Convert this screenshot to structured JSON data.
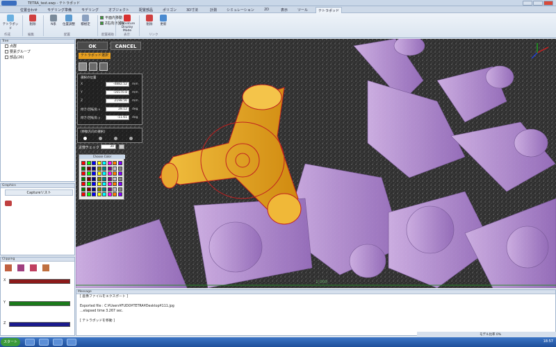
{
  "window": {
    "title": "TETRA_test.ewp - テトラポッド"
  },
  "tabs": [
    "位置合わせ",
    "モデリング準備",
    "モデリング",
    "オブジェクト",
    "配置部品",
    "ポリゴン",
    "3D寸法",
    "計測",
    "シミュレーション",
    "2D",
    "表示",
    "ツール",
    "テトラポッド"
  ],
  "ribbon": {
    "buttons": [
      {
        "label": "テトラポッド",
        "icon": "tetrapod-icon"
      },
      {
        "label": "削除",
        "icon": "delete-icon"
      },
      {
        "label": "N系",
        "icon": "n-system-icon"
      },
      {
        "label": "位置調整",
        "icon": "position-adjust-icon"
      },
      {
        "label": "積極定",
        "icon": "setting-icon"
      },
      {
        "label": "Curvature Display Mode",
        "icon": "curvature-icon"
      },
      {
        "label": "削除",
        "icon": "delete-icon-2"
      },
      {
        "label": "更新",
        "icon": "refresh-icon"
      }
    ],
    "checks": [
      {
        "label": "平面内移動",
        "checked": true
      },
      {
        "label": "Z右向き回転",
        "checked": true
      }
    ],
    "groups": [
      "作成",
      "編集",
      "配置",
      "配置補助",
      "表示",
      "リンク"
    ]
  },
  "tree": {
    "header": "Tree",
    "items": [
      {
        "label": "点群",
        "icon": "pointcloud-icon"
      },
      {
        "label": "要素グループ",
        "icon": "group-icon"
      },
      {
        "label": "部品(26)",
        "icon": "parts-icon"
      }
    ]
  },
  "capture": {
    "header": "Graphics",
    "tab": "Captureリスト"
  },
  "clipping": {
    "header": "Clipping",
    "axes": [
      "X",
      "Y",
      "Z"
    ]
  },
  "viewport": {
    "ok_label": "OK",
    "cancel_label": "CANCEL",
    "mode_label": "テトラポッド選択",
    "position_header": "選択の位置",
    "fields": [
      {
        "label": "X",
        "value": "-4882.52",
        "unit": "mm"
      },
      {
        "label": "Y",
        "value": "-16570.8",
        "unit": "mm"
      },
      {
        "label": "Z",
        "value": "2198.56",
        "unit": "mm"
      },
      {
        "label": "傾き/回転角 x",
        "value": "28.12",
        "unit": "deg"
      },
      {
        "label": "傾き/回転角 y",
        "value": "-11.61",
        "unit": "deg"
      }
    ],
    "rotate_header": "[移動方向の選択]",
    "radio_labels": [
      "x",
      "y",
      "z",
      "n"
    ],
    "check_label": "近傍チェック",
    "check_value": "30",
    "palette_title": "Choose Color",
    "scale_label": "1,000"
  },
  "message": {
    "header": "Message",
    "lines": [
      "[ 画像ファイルをエクスポート ]",
      "",
      "Exported file : C:¥Users¥FUDO¥TETRA¥Desktop¥111.jpg",
      "...elapsed time 3.267 sec.",
      "",
      "[ テトラポッドを移動 ]"
    ]
  },
  "status": {
    "text": "モデル比率 0%"
  },
  "taskbar": {
    "start": "スタート",
    "clock": "18:57"
  },
  "colors": {
    "tetrapod": "#b98fd6",
    "selected": "#e0a020",
    "accent": "#3a6ebf"
  }
}
